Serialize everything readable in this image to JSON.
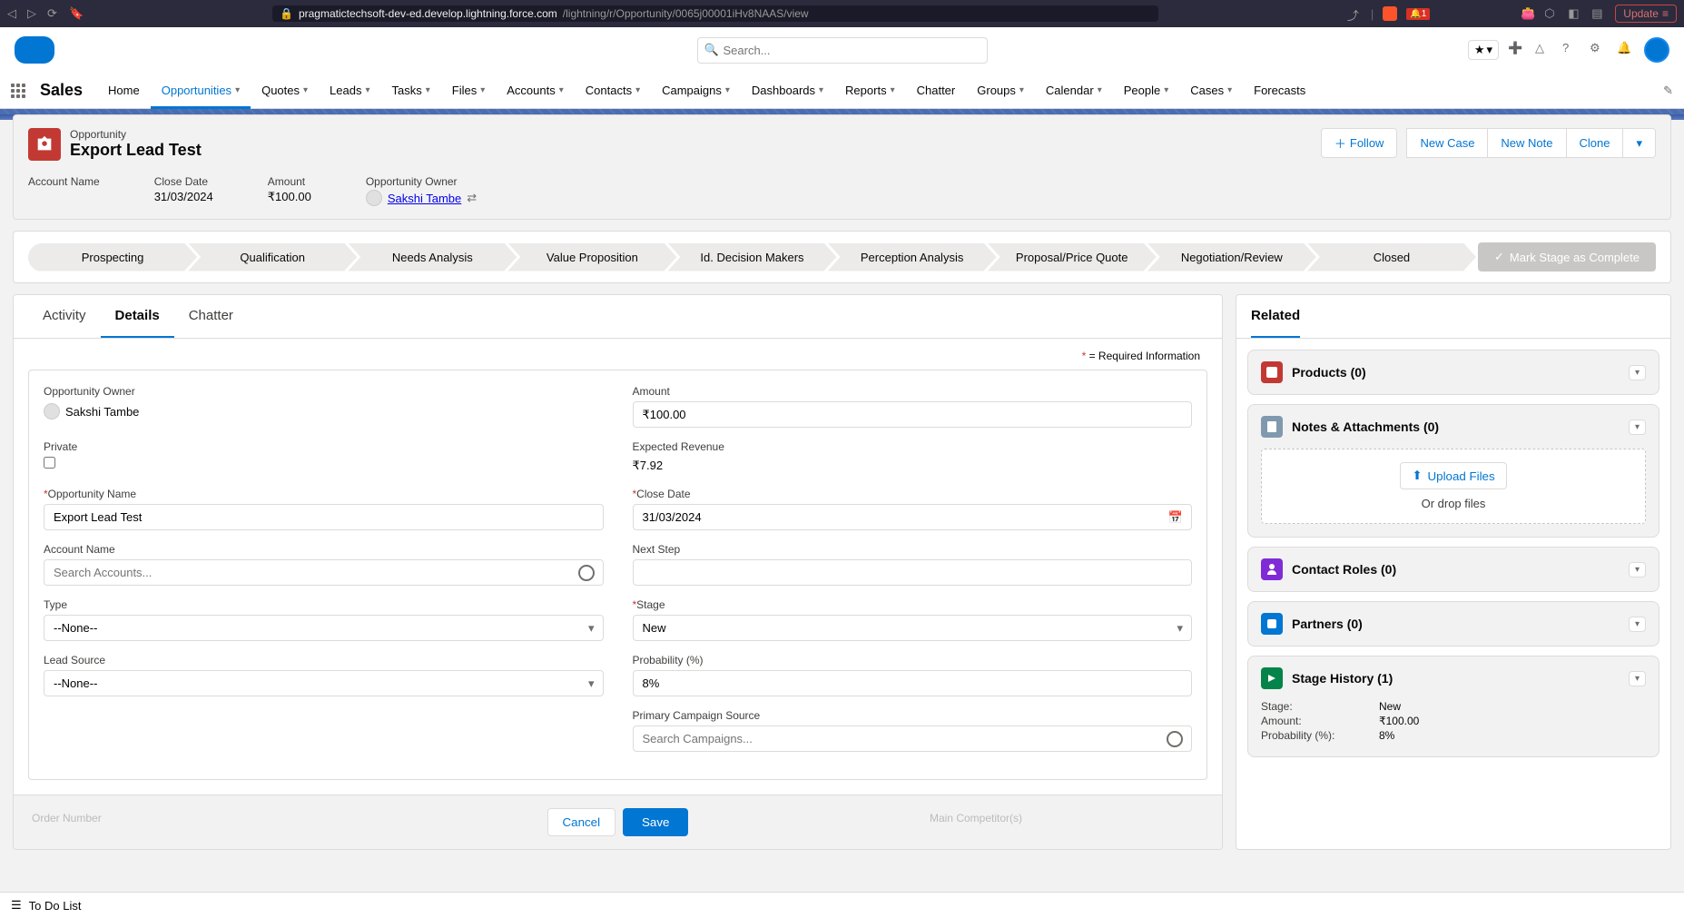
{
  "browser": {
    "url_host": "pragmatictechsoft-dev-ed.develop.lightning.force.com",
    "url_path": "/lightning/r/Opportunity/0065j00001iHv8NAAS/view",
    "update": "Update",
    "badge": "1"
  },
  "header": {
    "search_placeholder": "Search...",
    "app_name": "Sales"
  },
  "nav": {
    "items": [
      "Home",
      "Opportunities",
      "Quotes",
      "Leads",
      "Tasks",
      "Files",
      "Accounts",
      "Contacts",
      "Campaigns",
      "Dashboards",
      "Reports",
      "Chatter",
      "Groups",
      "Calendar",
      "People",
      "Cases",
      "Forecasts"
    ]
  },
  "record": {
    "type": "Opportunity",
    "title": "Export Lead Test",
    "actions": {
      "follow": "Follow",
      "new_case": "New Case",
      "new_note": "New Note",
      "clone": "Clone"
    },
    "fields": {
      "account_label": "Account Name",
      "account_val": "",
      "close_label": "Close Date",
      "close_val": "31/03/2024",
      "amount_label": "Amount",
      "amount_val": "₹100.00",
      "owner_label": "Opportunity Owner",
      "owner_val": "Sakshi Tambe"
    }
  },
  "path": {
    "steps": [
      "Prospecting",
      "Qualification",
      "Needs Analysis",
      "Value Proposition",
      "Id. Decision Makers",
      "Perception Analysis",
      "Proposal/Price Quote",
      "Negotiation/Review",
      "Closed"
    ],
    "button": "Mark Stage as Complete"
  },
  "tabs": {
    "activity": "Activity",
    "details": "Details",
    "chatter": "Chatter"
  },
  "form": {
    "required": "= Required Information",
    "owner_label": "Opportunity Owner",
    "owner_val": "Sakshi Tambe",
    "private_label": "Private",
    "oppname_label": "Opportunity Name",
    "oppname_val": "Export Lead Test",
    "account_label": "Account Name",
    "account_placeholder": "Search Accounts...",
    "type_label": "Type",
    "type_val": "--None--",
    "leadsource_label": "Lead Source",
    "leadsource_val": "--None--",
    "amount_label": "Amount",
    "amount_val": "₹100.00",
    "exprev_label": "Expected Revenue",
    "exprev_val": "₹7.92",
    "closedate_label": "Close Date",
    "closedate_val": "31/03/2024",
    "nextstep_label": "Next Step",
    "stage_label": "Stage",
    "stage_val": "New",
    "prob_label": "Probability (%)",
    "prob_val": "8%",
    "campaign_label": "Primary Campaign Source",
    "campaign_placeholder": "Search Campaigns...",
    "ordernum_label": "Order Number",
    "competitors_label": "Main Competitor(s)",
    "cancel": "Cancel",
    "save": "Save"
  },
  "related": {
    "tab": "Related",
    "products": "Products (0)",
    "notes": "Notes & Attachments (0)",
    "upload_btn": "Upload Files",
    "drop_text": "Or drop files",
    "contact_roles": "Contact Roles (0)",
    "partners": "Partners (0)",
    "stage_history": "Stage History (1)",
    "sh_stage_k": "Stage:",
    "sh_stage_v": "New",
    "sh_amount_k": "Amount:",
    "sh_amount_v": "₹100.00",
    "sh_prob_k": "Probability (%):",
    "sh_prob_v": "8%"
  },
  "footer": {
    "todo": "To Do List"
  }
}
